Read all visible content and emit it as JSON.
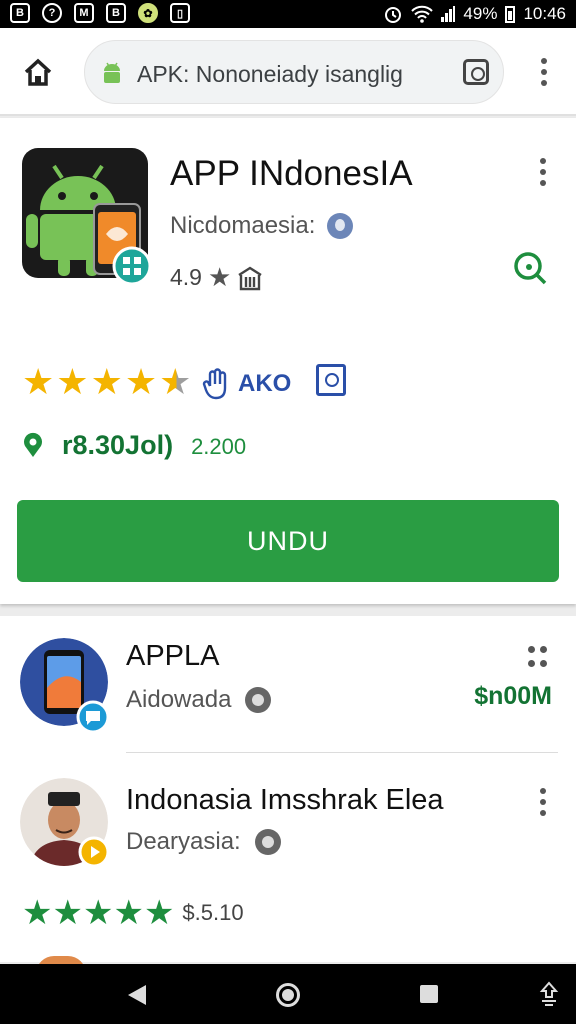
{
  "status_bar": {
    "left_icons": [
      "B",
      "?",
      "M",
      "B",
      "✿",
      "▯"
    ],
    "battery": "49%",
    "time": "10:46"
  },
  "browser": {
    "url": "APK: Nononeiady isanglig",
    "home_icon": "home-icon",
    "menu_icon": "more-vert-icon"
  },
  "featured_app": {
    "title": "APP INdonesIA",
    "developer": "Nicdomaesia:",
    "rating": "4.9",
    "stars": 4.5,
    "badge": "AKO",
    "price": "r8.30Jol)",
    "count": "2.200",
    "download_label": "UNDU",
    "accent_color": "#2a9d43"
  },
  "list_items": [
    {
      "title": "APPLA",
      "developer": "Aidowada",
      "price": "$n00M"
    },
    {
      "title": "Indonasia Imsshrak Elea",
      "developer": "Dearyasia:",
      "stars": 5,
      "price": "$.5.10"
    }
  ]
}
